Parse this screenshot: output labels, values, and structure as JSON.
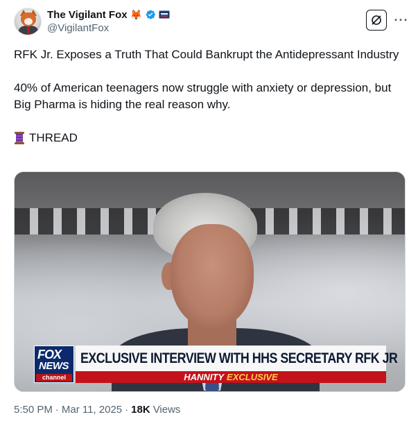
{
  "author": {
    "display_name": "The Vigilant Fox",
    "name_emoji": "🦊",
    "handle": "@VigilantFox",
    "verified": true,
    "avatar_icon": "fox-in-suit-avatar"
  },
  "actions": {
    "grok_icon": "grok-icon",
    "more_label": "···"
  },
  "tweet": {
    "paragraph_1": "RFK Jr. Exposes a Truth That Could Bankrupt the Antidepressant Industry",
    "paragraph_2": "40% of American teenagers now struggle with anxiety or depression, but Big Pharma is hiding the real reason why.",
    "thread_label": "THREAD",
    "thread_icon": "spool-of-thread-icon"
  },
  "media": {
    "logo_line1": "FOX",
    "logo_line2": "NEWS",
    "logo_line3": "channel",
    "headline": "EXCLUSIVE INTERVIEW WITH HHS SECRETARY RFK JR",
    "sub_show": "HANNITY",
    "sub_tag": "EXCLUSIVE"
  },
  "meta": {
    "time": "5:50 PM",
    "separator": "·",
    "date": "Mar 11, 2025",
    "views_count": "18K",
    "views_label": "Views"
  },
  "colors": {
    "text_primary": "#0f1419",
    "text_secondary": "#536471",
    "verified_blue": "#1d9bf0",
    "fox_blue": "#0c2a6b",
    "fox_red": "#c4121b"
  }
}
